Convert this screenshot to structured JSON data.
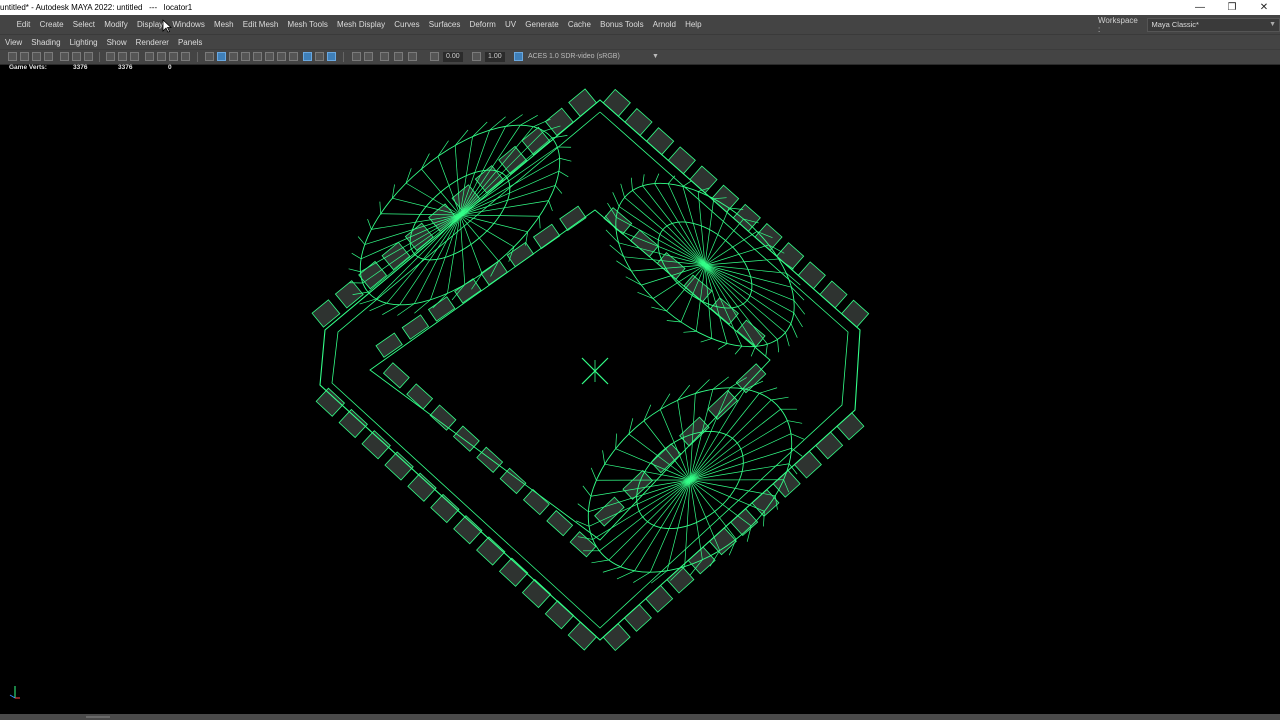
{
  "window": {
    "title": "untitled* - Autodesk MAYA 2022: untitled   ---   locator1",
    "minimize_glyph": "—",
    "restore_glyph": "❐",
    "close_glyph": "✕"
  },
  "main_menu": [
    "Edit",
    "Create",
    "Select",
    "Modify",
    "Display",
    "Windows",
    "Mesh",
    "Edit Mesh",
    "Mesh Tools",
    "Mesh Display",
    "Curves",
    "Surfaces",
    "Deform",
    "UV",
    "Generate",
    "Cache",
    "Bonus Tools",
    "Arnold",
    "Help"
  ],
  "workspace": {
    "label": "Workspace :",
    "value": "Maya Classic*"
  },
  "panel_menu": [
    "View",
    "Shading",
    "Lighting",
    "Show",
    "Renderer",
    "Panels"
  ],
  "toolbar": {
    "field_a": "0.00",
    "field_b": "1.00",
    "color_space": "ACES 1.0 SDR-video (sRGB)"
  },
  "hud": {
    "label": "Game Verts:",
    "v1": "3376",
    "v2": "3376",
    "v3": "0"
  },
  "colors": {
    "wire": "#33ff88",
    "background": "#000000",
    "menu_bg": "#444444"
  }
}
